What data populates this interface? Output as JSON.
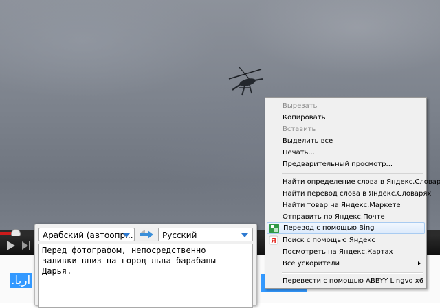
{
  "popup": {
    "source_lang": "Арабский (автоопр...",
    "target_lang": "Русский",
    "translation": "Перед фотографом, непосредственно\nзаливки вниз на город льва барабаны\nДарья."
  },
  "page": {
    "selected_text": "اريا."
  },
  "context_menu": {
    "items": [
      {
        "label": "Вырезать",
        "disabled": true
      },
      {
        "label": "Копировать",
        "disabled": false
      },
      {
        "label": "Вставить",
        "disabled": true
      },
      {
        "label": "Выделить все",
        "disabled": false
      },
      {
        "label": "Печать...",
        "disabled": false
      },
      {
        "label": "Предварительный просмотр...",
        "disabled": false
      },
      {
        "label": "Найти определение слова в Яндекс.Словарях",
        "disabled": false
      },
      {
        "label": "Найти перевод слова в Яндекс.Словарях",
        "disabled": false
      },
      {
        "label": "Найти товар на Яндекс.Маркете",
        "disabled": false
      },
      {
        "label": "Отправить по Яндекс.Почте",
        "disabled": false
      },
      {
        "label": "Перевод с помощью Bing",
        "disabled": false,
        "icon": "bing-translate-icon"
      },
      {
        "label": "Поиск с помощью Яндекс",
        "disabled": false,
        "icon": "yandex-icon"
      },
      {
        "label": "Посмотреть на Яндекс.Картах",
        "disabled": false
      },
      {
        "label": "Все ускорители",
        "disabled": false
      },
      {
        "label": "Перевести с помощью ABBYY Lingvo x6",
        "disabled": false
      }
    ]
  },
  "colors": {
    "selection": "#3399ff",
    "accent_arrow": "#2e7ad1",
    "player_progress": "#cc1b1b"
  }
}
